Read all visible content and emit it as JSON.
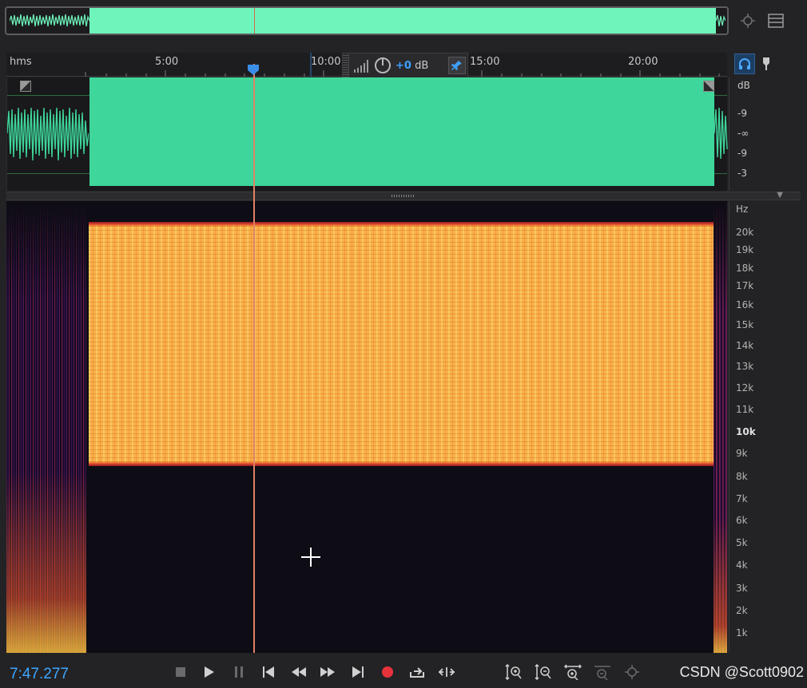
{
  "overview": {
    "accent": "#6ff5bb"
  },
  "top_icons": {
    "zoom_icon": "zoom-fit-icon",
    "menu_icon": "menu-list-icon"
  },
  "ruler": {
    "unit": "hms",
    "labels": [
      "5:00",
      "10:00",
      "15:00",
      "20:00"
    ]
  },
  "hud": {
    "gain_value": "+0",
    "gain_unit": "dB"
  },
  "side_tools": {
    "monitor": "headphones-icon",
    "marker": "marker-pin-icon"
  },
  "db_scale": {
    "unit": "dB",
    "labels": [
      "-9",
      "-∞",
      "-9",
      "-3"
    ]
  },
  "hz_scale": {
    "unit": "Hz",
    "labels": [
      "20k",
      "19k",
      "18k",
      "17k",
      "16k",
      "15k",
      "14k",
      "13k",
      "12k",
      "11k",
      "10k",
      "9k",
      "8k",
      "7k",
      "6k",
      "5k",
      "4k",
      "3k",
      "2k",
      "1k"
    ]
  },
  "transport": {
    "time": "7:47.277",
    "watermark": "CSDN @Scott0902"
  },
  "colors": {
    "accent": "#3da6ff",
    "record": "#e8323b",
    "playhead": "#e08266",
    "waveform": "#3ed69a"
  }
}
